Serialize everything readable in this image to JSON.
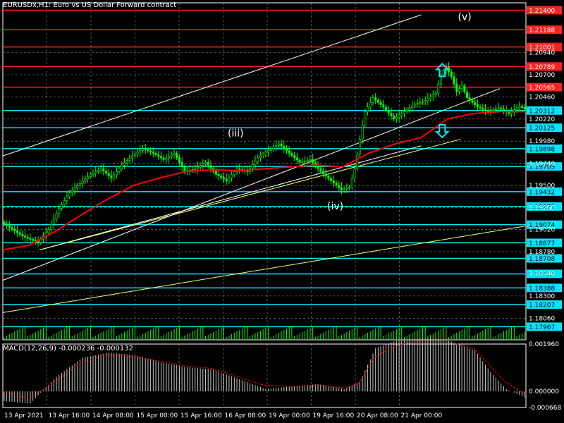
{
  "window": {
    "title": "EURUSDx,H1:  Euro vs US Dollar Forward contract"
  },
  "colors": {
    "background": "#000000",
    "candles": "#00ff00",
    "ma": "#ff0000",
    "trendline": "#ffffff",
    "yellow_line": "#ffff66",
    "support_level": "#00e5ff",
    "resistance_level": "#ff2020",
    "macd_hist": "#c8c8c8",
    "macd_signal": "#ff0000",
    "grid": "#ffffff",
    "arrow": "#00e5ff"
  },
  "chart_data": [
    {
      "type": "candlestick",
      "title": "EURUSDx,H1:  Euro vs US Dollar Forward contract",
      "ylim": [
        1.17825,
        1.2148
      ],
      "x_ticks": [
        "13 Apr 2021",
        "13 Apr 16:00",
        "14 Apr 08:00",
        "15 Apr 00:00",
        "15 Apr 16:00",
        "16 Apr 08:00",
        "19 Apr 00:00",
        "19 Apr 16:00",
        "20 Apr 08:00",
        "21 Apr 00:00"
      ],
      "y_ticks": [
        "1.20940",
        "1.20700",
        "1.20460",
        "1.20220",
        "1.19980",
        "1.19740",
        "1.19500",
        "1.19260",
        "1.19020",
        "1.18780",
        "1.18540",
        "1.18300",
        "1.18060"
      ],
      "price_levels": [
        {
          "value": 1.214,
          "label": "1.21400",
          "kind": "resistance"
        },
        {
          "value": 1.21188,
          "label": "1.21188",
          "kind": "resistance"
        },
        {
          "value": 1.21001,
          "label": "1.21001",
          "kind": "resistance"
        },
        {
          "value": 1.20789,
          "label": "1.20789",
          "kind": "resistance"
        },
        {
          "value": 1.20565,
          "label": "1.20565",
          "kind": "resistance"
        },
        {
          "value": 1.20312,
          "label": "1.20312",
          "kind": "support"
        },
        {
          "value": 1.20125,
          "label": "1.20125",
          "kind": "support"
        },
        {
          "value": 1.19898,
          "label": "1.19898",
          "kind": "support"
        },
        {
          "value": 1.19705,
          "label": "1.19705",
          "kind": "support"
        },
        {
          "value": 1.19432,
          "label": "1.19432",
          "kind": "support"
        },
        {
          "value": 1.19271,
          "label": "1.19271",
          "kind": "support"
        },
        {
          "value": 1.19074,
          "label": "1.19074",
          "kind": "support"
        },
        {
          "value": 1.18877,
          "label": "1.18877",
          "kind": "support"
        },
        {
          "value": 1.18708,
          "label": "1.18708",
          "kind": "support"
        },
        {
          "value": 1.1854,
          "label": "1.18540",
          "kind": "support"
        },
        {
          "value": 1.18388,
          "label": "1.18388",
          "kind": "support"
        },
        {
          "value": 1.18207,
          "label": "1.18207",
          "kind": "support"
        },
        {
          "value": 1.17967,
          "label": "1.17967",
          "kind": "support"
        }
      ],
      "current_price": "1.20312",
      "wave_labels": [
        "(iii)",
        "(iv)",
        "(v)"
      ],
      "arrows": [
        "up",
        "down"
      ],
      "price_path": [
        [
          0,
          1.191
        ],
        [
          8,
          1.1895
        ],
        [
          14,
          1.1888
        ],
        [
          18,
          1.1902
        ],
        [
          22,
          1.1925
        ],
        [
          26,
          1.1942
        ],
        [
          30,
          1.1952
        ],
        [
          34,
          1.1962
        ],
        [
          38,
          1.1968
        ],
        [
          42,
          1.1958
        ],
        [
          46,
          1.1972
        ],
        [
          50,
          1.1982
        ],
        [
          54,
          1.199
        ],
        [
          58,
          1.1985
        ],
        [
          62,
          1.1978
        ],
        [
          66,
          1.1985
        ],
        [
          70,
          1.1965
        ],
        [
          74,
          1.1968
        ],
        [
          78,
          1.1975
        ],
        [
          82,
          1.1962
        ],
        [
          86,
          1.1955
        ],
        [
          90,
          1.1968
        ],
        [
          94,
          1.1965
        ],
        [
          98,
          1.198
        ],
        [
          102,
          1.1988
        ],
        [
          106,
          1.1995
        ],
        [
          110,
          1.1985
        ],
        [
          114,
          1.1975
        ],
        [
          118,
          1.1978
        ],
        [
          122,
          1.1965
        ],
        [
          126,
          1.1955
        ],
        [
          130,
          1.1945
        ],
        [
          133,
          1.1948
        ],
        [
          135,
          1.1968
        ],
        [
          137,
          1.2
        ],
        [
          139,
          1.203
        ],
        [
          142,
          1.2045
        ],
        [
          146,
          1.2035
        ],
        [
          150,
          1.2022
        ],
        [
          154,
          1.203
        ],
        [
          158,
          1.2038
        ],
        [
          162,
          1.2042
        ],
        [
          166,
          1.205
        ],
        [
          168,
          1.207
        ],
        [
          170,
          1.2078
        ],
        [
          172,
          1.2068
        ],
        [
          174,
          1.2052
        ],
        [
          176,
          1.2058
        ],
        [
          178,
          1.2045
        ],
        [
          182,
          1.2035
        ],
        [
          186,
          1.203
        ],
        [
          190,
          1.2034
        ],
        [
          194,
          1.2028
        ],
        [
          198,
          1.2036
        ],
        [
          200,
          1.2033
        ]
      ],
      "ma_path": [
        [
          0,
          1.188
        ],
        [
          10,
          1.1885
        ],
        [
          20,
          1.19
        ],
        [
          30,
          1.1918
        ],
        [
          40,
          1.1935
        ],
        [
          50,
          1.195
        ],
        [
          60,
          1.1958
        ],
        [
          70,
          1.1965
        ],
        [
          80,
          1.1967
        ],
        [
          90,
          1.1966
        ],
        [
          100,
          1.1968
        ],
        [
          110,
          1.197
        ],
        [
          120,
          1.1972
        ],
        [
          130,
          1.197
        ],
        [
          140,
          1.1985
        ],
        [
          150,
          1.1995
        ],
        [
          160,
          1.2002
        ],
        [
          170,
          1.2022
        ],
        [
          180,
          1.2028
        ],
        [
          190,
          1.203
        ],
        [
          200,
          1.203
        ]
      ]
    },
    {
      "type": "bar",
      "title": "MACD(12,26,9) -0.000236 -0.000132",
      "ylim": [
        -0.000668,
        0.00196
      ],
      "y_ticks": [
        "0.001960",
        "0.000000",
        "-0.000668"
      ],
      "histogram_path": [
        [
          0,
          -0.0004
        ],
        [
          10,
          -0.0005
        ],
        [
          20,
          0.0006
        ],
        [
          30,
          0.0014
        ],
        [
          40,
          0.0016
        ],
        [
          50,
          0.0015
        ],
        [
          60,
          0.0012
        ],
        [
          70,
          0.001
        ],
        [
          80,
          0.0009
        ],
        [
          90,
          0.0005
        ],
        [
          100,
          0.0001
        ],
        [
          110,
          0.0002
        ],
        [
          120,
          0.0003
        ],
        [
          130,
          0.0001
        ],
        [
          136,
          0.0004
        ],
        [
          142,
          0.0018
        ],
        [
          150,
          0.0021
        ],
        [
          160,
          0.0022
        ],
        [
          170,
          0.0021
        ],
        [
          180,
          0.0017
        ],
        [
          186,
          0.0008
        ],
        [
          192,
          0.0001
        ],
        [
          200,
          -0.0003
        ]
      ],
      "signal_path": [
        [
          0,
          0.0
        ],
        [
          10,
          -0.0003
        ],
        [
          20,
          0.0004
        ],
        [
          30,
          0.0012
        ],
        [
          40,
          0.0015
        ],
        [
          50,
          0.00145
        ],
        [
          60,
          0.00125
        ],
        [
          70,
          0.00105
        ],
        [
          80,
          0.00095
        ],
        [
          90,
          0.0006
        ],
        [
          100,
          0.00025
        ],
        [
          110,
          0.0002
        ],
        [
          120,
          0.00025
        ],
        [
          130,
          0.00015
        ],
        [
          136,
          0.0003
        ],
        [
          142,
          0.0014
        ],
        [
          150,
          0.0019
        ],
        [
          160,
          0.0021
        ],
        [
          170,
          0.00205
        ],
        [
          180,
          0.0018
        ],
        [
          186,
          0.0011
        ],
        [
          192,
          0.0004
        ],
        [
          200,
          -0.00013
        ]
      ]
    }
  ]
}
